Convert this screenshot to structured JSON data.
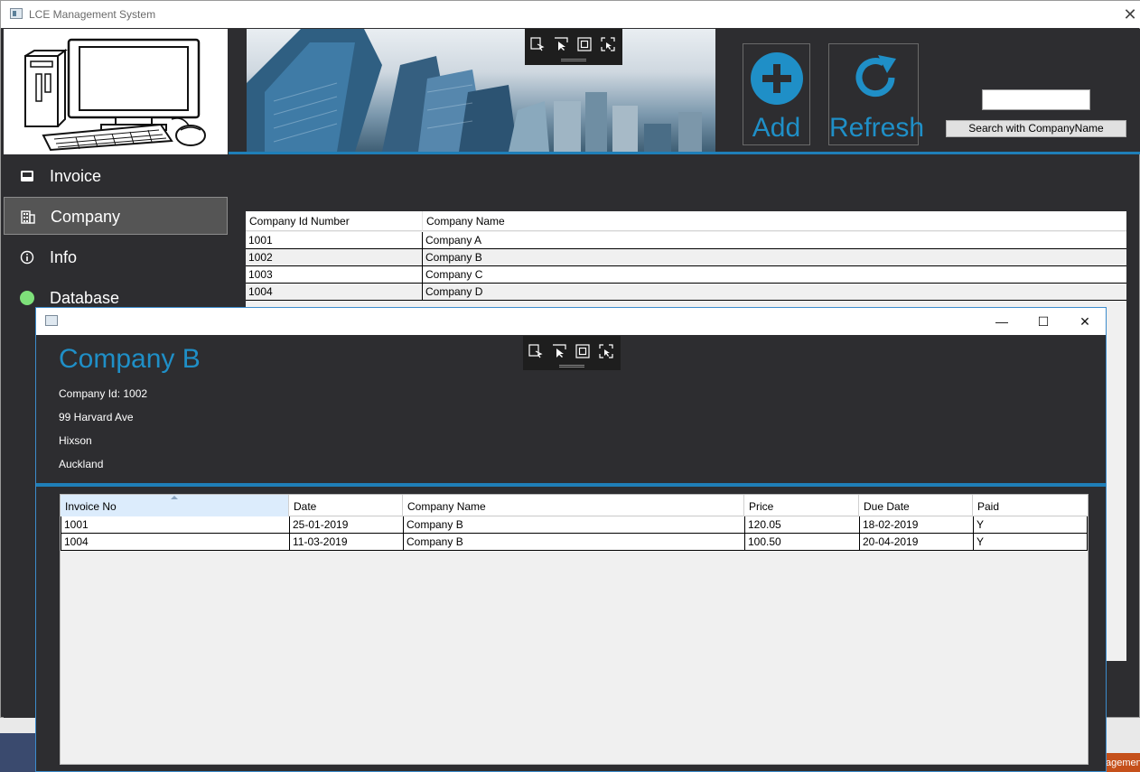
{
  "main_window": {
    "title": "LCE Management System",
    "close_glyph": "✕"
  },
  "sidebar": {
    "items": [
      {
        "label": "Invoice",
        "icon": "inbox-icon"
      },
      {
        "label": "Company",
        "icon": "building-icon"
      },
      {
        "label": "Info",
        "icon": "info-icon"
      },
      {
        "label": "Database",
        "icon": "status-dot-icon"
      }
    ],
    "active": "Company",
    "database_status_color": "#7ee07a"
  },
  "toolbar": {
    "add_label": "Add",
    "refresh_label": "Refresh",
    "search_button_label": "Search with CompanyName",
    "search_value": ""
  },
  "company_grid": {
    "columns": [
      "Company Id Number",
      "Company Name"
    ],
    "rows": [
      {
        "id": "1001",
        "name": "Company A"
      },
      {
        "id": "1002",
        "name": "Company B"
      },
      {
        "id": "1003",
        "name": "Company C"
      },
      {
        "id": "1004",
        "name": "Company D"
      }
    ]
  },
  "detail_window": {
    "company_name": "Company B",
    "company_id": "Company Id: 1002",
    "address_line1": "99 Harvard Ave",
    "address_line2": "Hixson",
    "address_line3": "Auckland",
    "minimize_glyph": "—",
    "maximize_glyph": "☐",
    "close_glyph": "✕"
  },
  "invoice_grid": {
    "columns": [
      "Invoice No",
      "Date",
      "Company Name",
      "Price",
      "Due Date",
      "Paid"
    ],
    "sorted_column": "Invoice No",
    "rows": [
      {
        "invoice_no": "1001",
        "date": "25-01-2019",
        "company": "Company B",
        "price": "120.05",
        "due": "18-02-2019",
        "paid": "Y"
      },
      {
        "invoice_no": "1004",
        "date": "11-03-2019",
        "company": "Company B",
        "price": "100.50",
        "due": "20-04-2019",
        "paid": "Y"
      }
    ]
  },
  "taskbar": {
    "partial_text": "agemen"
  },
  "colors": {
    "accent": "#1f8fc7",
    "window_background": "#2d2d30",
    "divider": "#1f7fb8"
  }
}
